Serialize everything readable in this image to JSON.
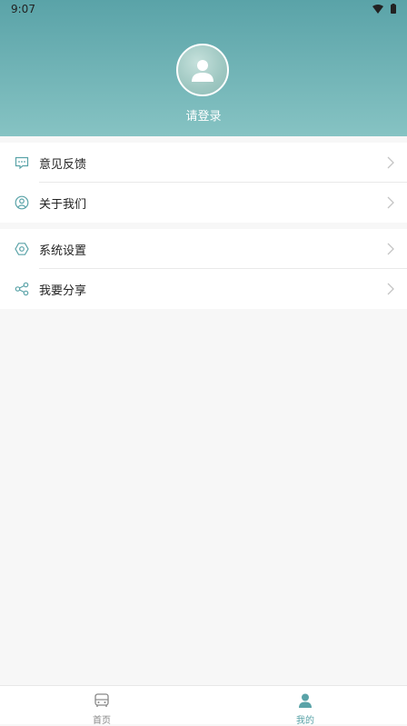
{
  "status_bar": {
    "time": "9:07",
    "icons": [
      "wifi-icon",
      "battery-icon"
    ]
  },
  "profile": {
    "login_label": "请登录",
    "avatar_icon": "user-avatar-icon"
  },
  "menu_groups": [
    [
      {
        "label": "意见反馈",
        "icon": "feedback-icon"
      },
      {
        "label": "关于我们",
        "icon": "about-us-icon"
      }
    ],
    [
      {
        "label": "系统设置",
        "icon": "settings-icon"
      },
      {
        "label": "我要分享",
        "icon": "share-icon"
      }
    ]
  ],
  "tabbar": {
    "items": [
      {
        "label": "首页",
        "icon": "bus-icon",
        "active": false
      },
      {
        "label": "我的",
        "icon": "user-icon",
        "active": true
      }
    ]
  },
  "colors": {
    "accent": "#5aa3a8",
    "header_top": "#5aa3a8",
    "header_bottom": "#86c3c3",
    "background": "#f7f7f7"
  }
}
